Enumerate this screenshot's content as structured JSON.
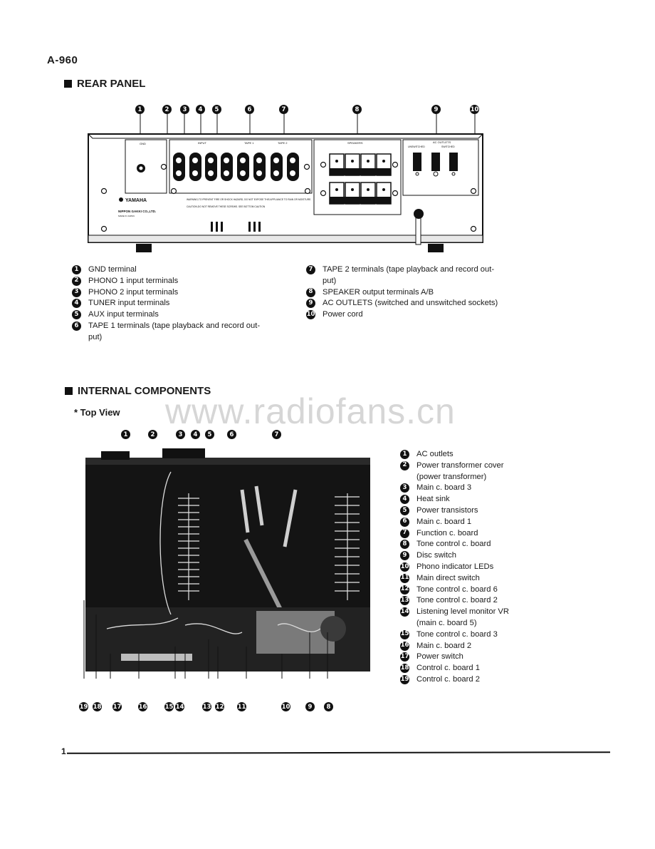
{
  "page": {
    "model": "A-960",
    "page_number": "1",
    "watermark": "www.radiofans.cn"
  },
  "rear_panel": {
    "title": "REAR PANEL",
    "callouts": [
      "1",
      "2",
      "3",
      "4",
      "5",
      "6",
      "7",
      "8",
      "9",
      "10"
    ],
    "panel_labels": {
      "gnd": "GND",
      "input": "INPUT",
      "tape1": "TAPE 1",
      "tape2": "TAPE 2",
      "speakers": "SPEAKERS",
      "ac_outlets": "AC OUTLETS",
      "unswitched": "UNSWITCHED",
      "switched": "SWITCHED",
      "brand": "YAMAHA",
      "maker": "NIPPON GAKKI CO.,LTD.",
      "made_in": "MADE IN JAPAN",
      "warning": "WARNING-TO PREVENT FIRE OR SHOCK HAZARD, DO NOT EXPOSE THIS APPLIANCE TO RAIN OR MOISTURE.",
      "caution": "CAUTION-DO NOT REMOVE THESE SCREWS. SEE BOTTOM CAUTION"
    },
    "legend": [
      {
        "n": "1",
        "text": "GND terminal"
      },
      {
        "n": "2",
        "text": "PHONO 1 input terminals"
      },
      {
        "n": "3",
        "text": "PHONO 2 input terminals"
      },
      {
        "n": "4",
        "text": "TUNER input terminals"
      },
      {
        "n": "5",
        "text": "AUX input terminals"
      },
      {
        "n": "6",
        "text": "TAPE 1 terminals (tape playback and record out-\nput)"
      },
      {
        "n": "7",
        "text": "TAPE 2 terminals (tape playback and record out-\nput)"
      },
      {
        "n": "8",
        "text": "SPEAKER output terminals A/B"
      },
      {
        "n": "9",
        "text": "AC OUTLETS (switched and unswitched sockets)"
      },
      {
        "n": "10",
        "text": "Power cord"
      }
    ]
  },
  "internal": {
    "title": "INTERNAL COMPONENTS",
    "subtitle": "*  Top View",
    "top_callouts": [
      "1",
      "2",
      "3",
      "4",
      "5",
      "6",
      "7"
    ],
    "bottom_callouts": [
      "19",
      "18",
      "17",
      "16",
      "15",
      "14",
      "13",
      "12",
      "11",
      "10",
      "9",
      "8"
    ],
    "legend": [
      {
        "n": "1",
        "text": "AC outlets"
      },
      {
        "n": "2",
        "text": "Power transformer cover\n(power transformer)"
      },
      {
        "n": "3",
        "text": "Main c. board 3"
      },
      {
        "n": "4",
        "text": "Heat sink"
      },
      {
        "n": "5",
        "text": "Power transistors"
      },
      {
        "n": "6",
        "text": "Main c. board 1"
      },
      {
        "n": "7",
        "text": "Function c. board"
      },
      {
        "n": "8",
        "text": "Tone control c. board"
      },
      {
        "n": "9",
        "text": "Disc switch"
      },
      {
        "n": "10",
        "text": "Phono indicator LEDs"
      },
      {
        "n": "11",
        "text": "Main direct switch"
      },
      {
        "n": "12",
        "text": "Tone control c. board 6"
      },
      {
        "n": "13",
        "text": "Tone control c. board 2"
      },
      {
        "n": "14",
        "text": "Listening level monitor VR\n(main c. board 5)"
      },
      {
        "n": "15",
        "text": "Tone control c. board 3"
      },
      {
        "n": "16",
        "text": "Main c. board 2"
      },
      {
        "n": "17",
        "text": "Power switch"
      },
      {
        "n": "18",
        "text": "Control c. board 1"
      },
      {
        "n": "19",
        "text": "Control c. board 2"
      }
    ]
  }
}
